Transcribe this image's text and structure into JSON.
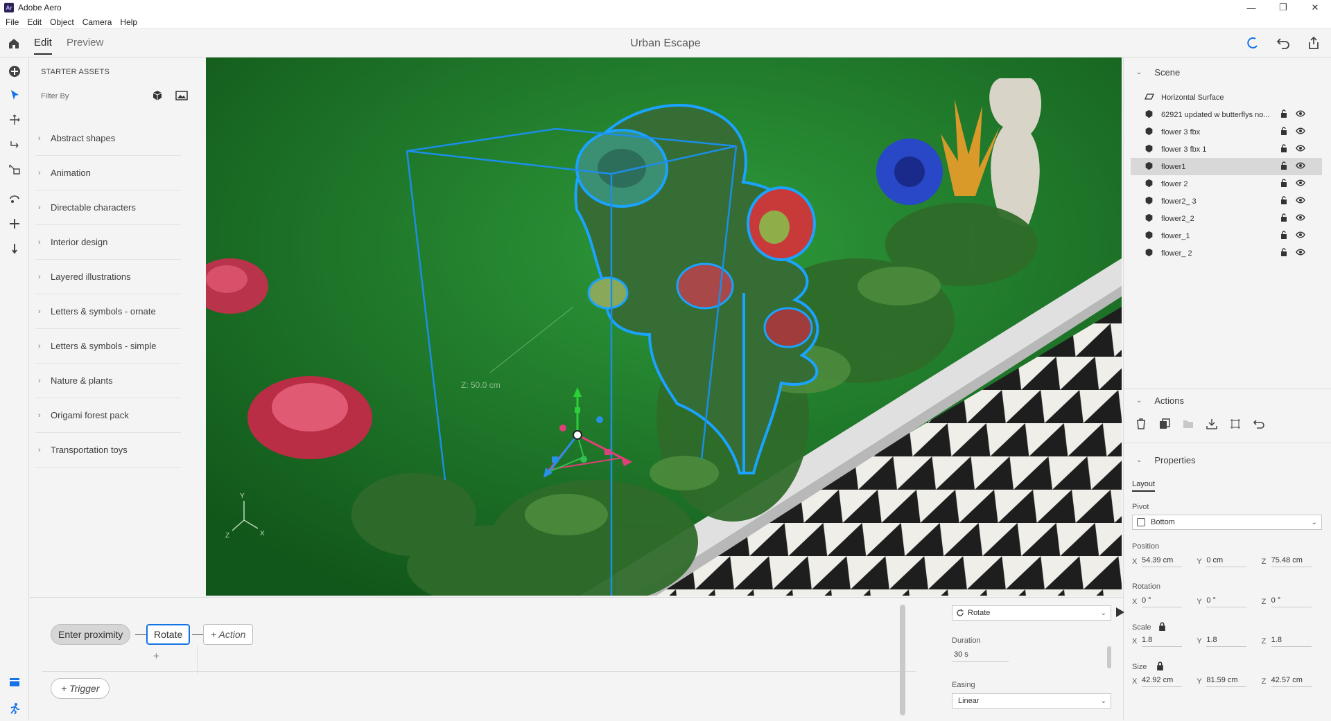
{
  "titlebar": {
    "app_logo": "Ar",
    "title": "Adobe Aero",
    "minimize": "—",
    "maximize": "❐",
    "close": "✕"
  },
  "menu": [
    "File",
    "Edit",
    "Object",
    "Camera",
    "Help"
  ],
  "appbar": {
    "tabs": [
      "Edit",
      "Preview"
    ],
    "active_tab": "Edit",
    "doc_title": "Urban Escape"
  },
  "assets": {
    "title": "STARTER ASSETS",
    "filter_label": "Filter By",
    "items": [
      "Abstract shapes",
      "Animation",
      "Directable characters",
      "Interior design",
      "Layered illustrations",
      "Letters & symbols - ornate",
      "Letters & symbols - simple",
      "Nature & plants",
      "Origami forest pack",
      "Transportation toys"
    ]
  },
  "viewport": {
    "z_readout": "Z: 50.0 cm",
    "gizmo_axes": [
      "Y",
      "Z",
      "X"
    ]
  },
  "scene": {
    "title": "Scene",
    "surface": "Horizontal Surface",
    "objects": [
      "62921 updated w butterflys no...",
      "flower 3 fbx",
      "flower 3 fbx 1",
      "flower1",
      "flower 2",
      "flower2_ 3",
      "flower2_2",
      "flower_1",
      "flower_ 2"
    ],
    "selected": "flower1"
  },
  "actions_panel": {
    "title": "Actions"
  },
  "properties": {
    "title": "Properties",
    "tab": "Layout",
    "pivot_label": "Pivot",
    "pivot_value": "Bottom",
    "position_label": "Position",
    "position": {
      "x": "54.39 cm",
      "y": "0 cm",
      "z": "75.48 cm"
    },
    "rotation_label": "Rotation",
    "rotation": {
      "x": "0 °",
      "y": "0 °",
      "z": "0 °"
    },
    "scale_label": "Scale",
    "scale": {
      "x": "1.8",
      "y": "1.8",
      "z": "1.8"
    },
    "size_label": "Size",
    "size": {
      "x": "42.92 cm",
      "y": "81.59 cm",
      "z": "42.57 cm"
    },
    "axis_labels": {
      "x": "X",
      "y": "Y",
      "z": "Z"
    }
  },
  "behaviors": {
    "trigger": "Enter proximity",
    "action": "Rotate",
    "add_action": "+ Action",
    "add_trigger": "+ Trigger",
    "plus": "+"
  },
  "action_config": {
    "type": "Rotate",
    "duration_label": "Duration",
    "duration_value": "30 s",
    "easing_label": "Easing",
    "easing_value": "Linear"
  },
  "colors": {
    "accent": "#1473e6",
    "selection_outline": "#1aa3ff",
    "viewport_bg": "#1d7a22"
  }
}
